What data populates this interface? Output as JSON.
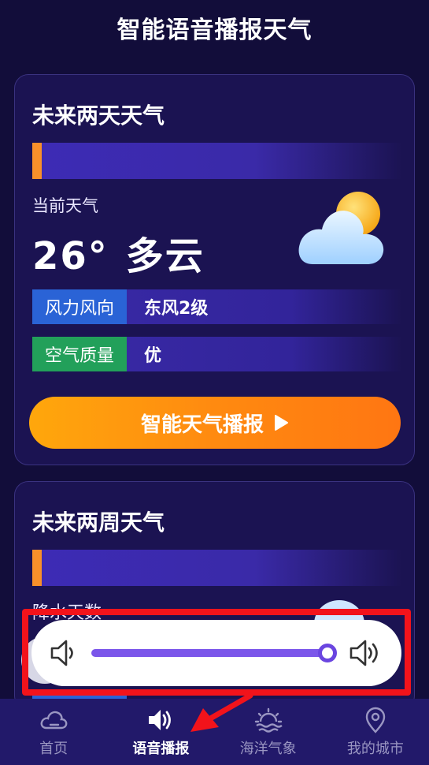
{
  "header": {
    "title": "智能语音播报天气"
  },
  "card_two_days": {
    "title": "未来两天天气",
    "current_label": "当前天气",
    "temperature": "26°",
    "condition": "多云",
    "weather_icon": "partly-cloudy-icon",
    "rows": [
      {
        "tag": "风力风向",
        "value": "东风2级",
        "tag_color": "#2a63d6"
      },
      {
        "tag": "空气质量",
        "value": "优",
        "tag_color": "#22a05a"
      }
    ],
    "broadcast_button": "智能天气播报"
  },
  "card_two_weeks": {
    "title": "未来两周天气",
    "partial_label": "降水天数"
  },
  "volume_popup": {
    "level": 1.0,
    "icon_left": "volume-low-icon",
    "icon_right": "volume-high-icon"
  },
  "bottom_nav": [
    {
      "label": "首页",
      "icon": "cloud-icon",
      "active": false
    },
    {
      "label": "语音播报",
      "icon": "speaker-icon",
      "active": true
    },
    {
      "label": "海洋气象",
      "icon": "sunrise-sea-icon",
      "active": false
    },
    {
      "label": "我的城市",
      "icon": "location-pin-icon",
      "active": false
    }
  ],
  "colors": {
    "background": "#120d3a",
    "card": "#1b1352",
    "accent_orange": "#ff8a10",
    "slider": "#7b56ea",
    "highlight_frame": "#f2131b"
  }
}
